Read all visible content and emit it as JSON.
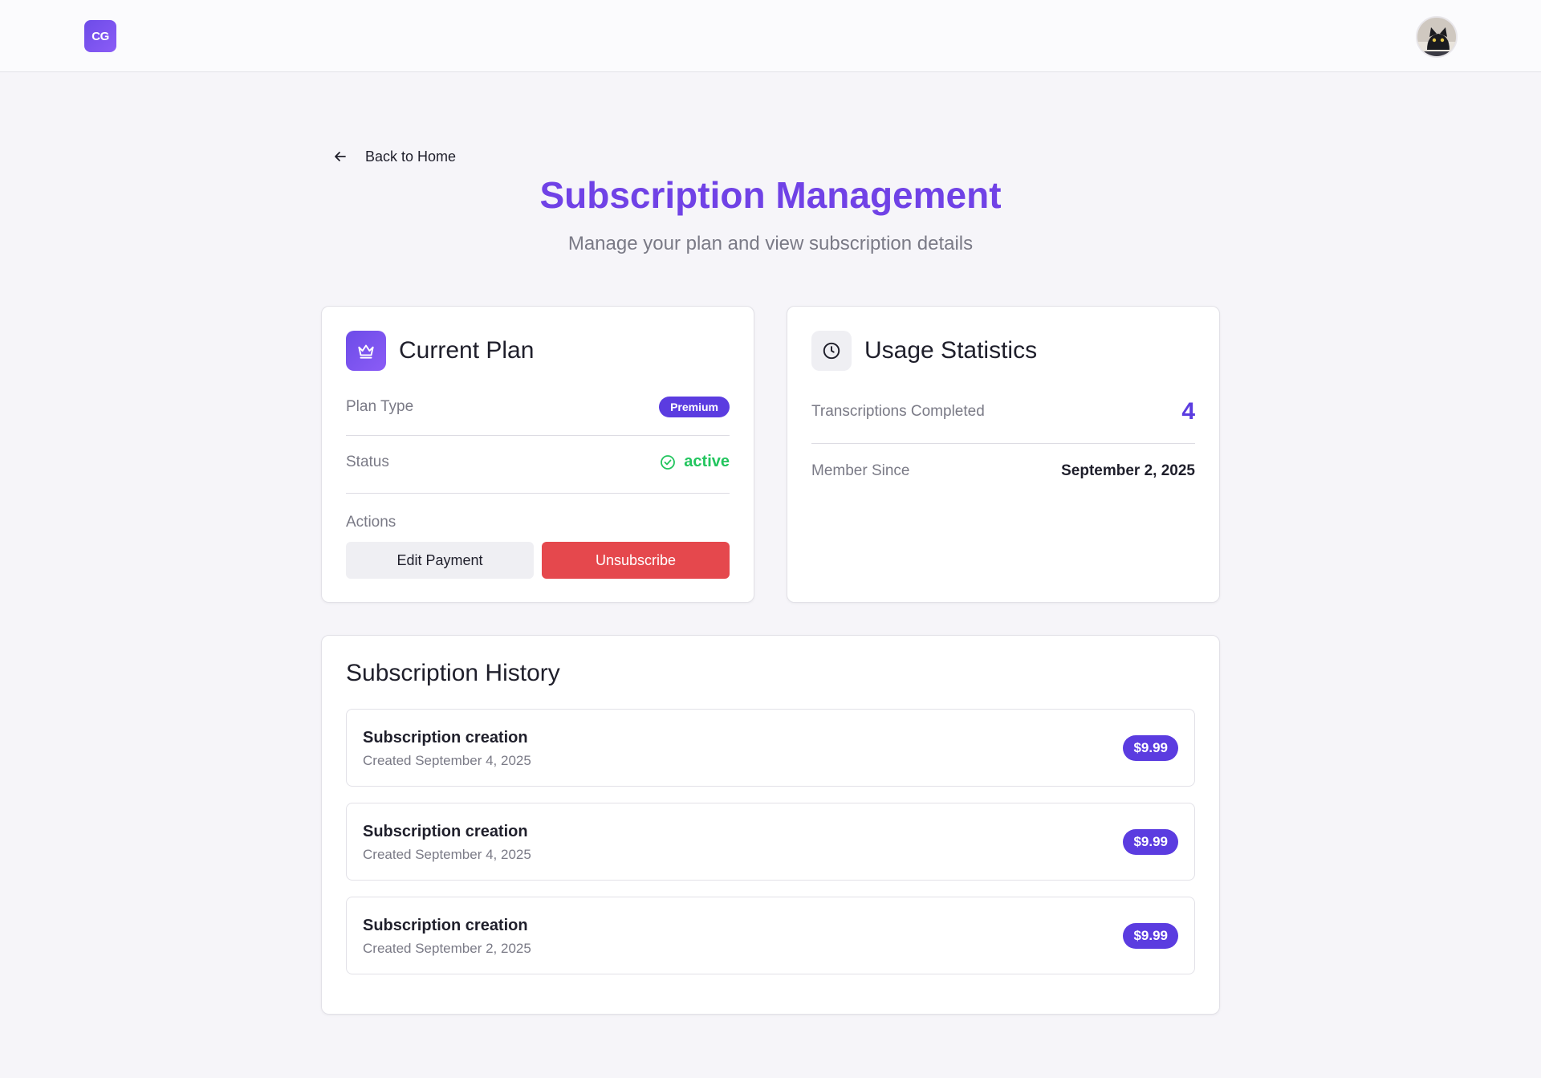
{
  "header": {
    "logo_text": "CG",
    "avatar_alt": "user avatar"
  },
  "nav": {
    "back_label": "Back to Home"
  },
  "page": {
    "title": "Subscription Management",
    "subtitle": "Manage your plan and view subscription details"
  },
  "current_plan": {
    "title": "Current Plan",
    "plan_type_label": "Plan Type",
    "plan_type_value": "Premium",
    "status_label": "Status",
    "status_value": "active",
    "actions_label": "Actions",
    "edit_payment_label": "Edit Payment",
    "unsubscribe_label": "Unsubscribe"
  },
  "usage": {
    "title": "Usage Statistics",
    "transcriptions_label": "Transcriptions Completed",
    "transcriptions_value": "4",
    "member_since_label": "Member Since",
    "member_since_value": "September 2, 2025"
  },
  "history": {
    "title": "Subscription History",
    "items": [
      {
        "title": "Subscription creation",
        "date": "Created September 4, 2025",
        "price": "$9.99"
      },
      {
        "title": "Subscription creation",
        "date": "Created September 4, 2025",
        "price": "$9.99"
      },
      {
        "title": "Subscription creation",
        "date": "Created September 2, 2025",
        "price": "$9.99"
      }
    ]
  },
  "colors": {
    "accent": "#7042e6",
    "badge": "#5b3ce0",
    "success": "#22c55e",
    "danger": "#e5484d"
  },
  "icons": {
    "back": "arrow-left-icon",
    "plan": "crown-icon",
    "usage": "clock-icon",
    "status": "check-circle-icon"
  }
}
